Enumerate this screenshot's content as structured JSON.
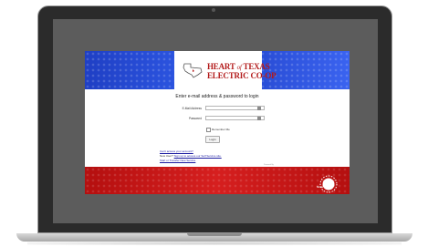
{
  "logo": {
    "heart_of_texas": "HEART of TEXAS",
    "of_word": "of",
    "heart": "HEART ",
    "texas": " TEXAS",
    "electric_coop": "ELECTRIC CO-OP",
    "colors": {
      "brand_red": "#b31b1b",
      "brand_blue": "#2f5ae8"
    }
  },
  "login": {
    "title": "Enter e-mail address & password to login",
    "email_label": "E-Mail Address",
    "email_value": "",
    "password_label": "Password",
    "password_value": "",
    "remember_label": "Remember Me",
    "remember_checked": false,
    "login_button": "Login",
    "forgot_link": "Can't access your account?",
    "new_user_prefix": "New User? ",
    "new_user_link": "Sign up to access our Self Service site.",
    "transfer_link": "Start or Transfer New Service",
    "powered_by": "Powered By"
  },
  "footer": {
    "badge_text": "SmartHub"
  },
  "icons": {
    "email_field_icon": "key-icon",
    "password_field_icon": "key-icon"
  }
}
